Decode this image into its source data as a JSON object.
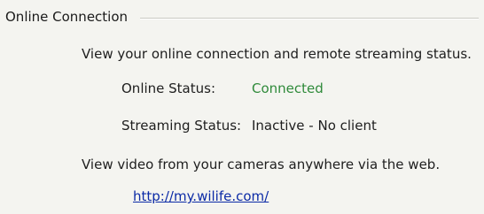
{
  "group": {
    "title": "Online Connection"
  },
  "description": "View your online connection and remote streaming status.",
  "status": {
    "online_label": "Online Status:",
    "online_value": "Connected",
    "online_value_color": "#2f8a3a",
    "streaming_label": "Streaming Status:",
    "streaming_value": "Inactive - No client"
  },
  "remote": {
    "text": "View video from your cameras anywhere via the web.",
    "link": "http://my.wilife.com/"
  }
}
